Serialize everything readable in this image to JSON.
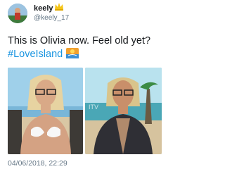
{
  "tweet": {
    "display_name": "keely",
    "badge_icon": "crown-icon",
    "username": "@keely_17",
    "text_line": "This is Olivia now. Feel old yet?",
    "hashtag": "#LoveIsland",
    "hashtag_emoji": "island-emoji",
    "timestamp": "04/06/2018, 22:29"
  },
  "media": [
    {
      "name": "photo-bikini"
    },
    {
      "name": "photo-jacket",
      "watermark_text": "ITV"
    }
  ],
  "colors": {
    "text": "#14171a",
    "secondary_text": "#657786",
    "link": "#1b95e0",
    "background": "#ffffff"
  }
}
